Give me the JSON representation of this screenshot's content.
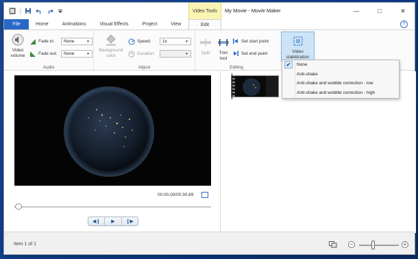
{
  "window": {
    "title": "My Movie - Movie Maker",
    "context_tab_header": "Video Tools"
  },
  "tabs": [
    "File",
    "Home",
    "Animations",
    "Visual Effects",
    "Project",
    "View",
    "Edit"
  ],
  "ribbon": {
    "audio": {
      "label": "Audio",
      "video_volume": "Video\nvolume",
      "fade_in_label": "Fade in:",
      "fade_in_value": "None",
      "fade_out_label": "Fade out:",
      "fade_out_value": "None"
    },
    "adjust": {
      "label": "Adjust",
      "background_color": "Background\ncolor",
      "speed_label": "Speed:",
      "speed_value": "1x",
      "duration_label": "Duration:",
      "duration_value": ""
    },
    "editing": {
      "label": "Editing",
      "split": "Split",
      "trim_tool": "Trim\ntool",
      "set_start_point": "Set start point",
      "set_end_point": "Set end point",
      "video_stabilization": "Video\nstabilization"
    }
  },
  "stabilization_menu": {
    "items": [
      {
        "label": "None",
        "checked": true
      },
      {
        "label": "Anti-shake",
        "checked": false
      },
      {
        "label": "Anti-shake and wobble correction - low",
        "checked": false
      },
      {
        "label": "Anti-shake and wobble correction - high",
        "checked": false
      }
    ]
  },
  "preview": {
    "timecode": "00:00,00/00:30,69",
    "seek_position": 0
  },
  "status": {
    "item_text": "Item 1 of 1",
    "zoom_position": 0.35
  },
  "colors": {
    "file_tab": "#2a68c8",
    "context_tab": "#fbf5b4",
    "selected_button": "#cde4f7"
  }
}
